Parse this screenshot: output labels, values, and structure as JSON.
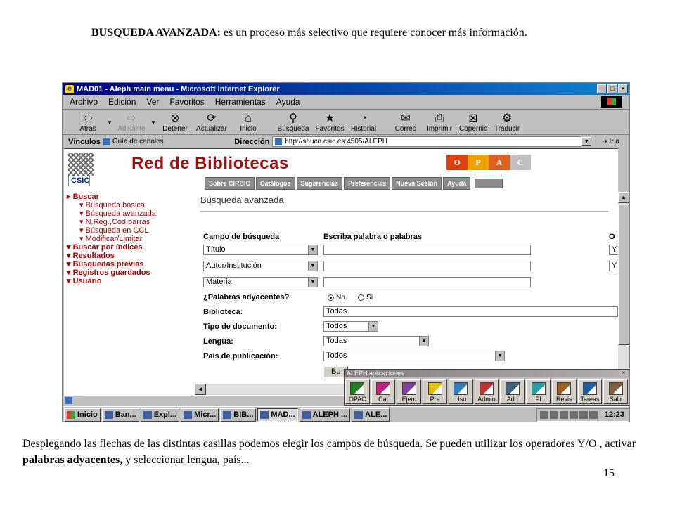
{
  "slide": {
    "title_bold": "BUSQUEDA AVANZADA:",
    "title_rest": " es un proceso más selectivo que requiere conocer más información.",
    "caption_part1": "Desplegando las flechas de las distintas casillas podemos elegir los campos de búsqueda. Se  pueden utilizar los operadores Y/O , activar ",
    "caption_bold": "palabras adyacentes,",
    "caption_part2": " y seleccionar lengua, país...",
    "page_number": "15"
  },
  "browser": {
    "window_title": "MAD01 - Aleph main menu - Microsoft Internet Explorer",
    "menu": [
      "Archivo",
      "Edición",
      "Ver",
      "Favoritos",
      "Herramientas",
      "Ayuda"
    ],
    "toolbar": [
      {
        "label": "Atrás",
        "icon": "back-arrow-icon",
        "glyph": "⇦"
      },
      {
        "label": "Adelante",
        "icon": "forward-arrow-icon",
        "glyph": "⇨"
      },
      {
        "label": "Detener",
        "icon": "stop-icon",
        "glyph": "⊗"
      },
      {
        "label": "Actualizar",
        "icon": "refresh-icon",
        "glyph": "⟳"
      },
      {
        "label": "Inicio",
        "icon": "home-icon",
        "glyph": "⌂"
      },
      {
        "label": "Búsqueda",
        "icon": "search-icon",
        "glyph": "⚲"
      },
      {
        "label": "Favoritos",
        "icon": "favorites-icon",
        "glyph": "★"
      },
      {
        "label": "Historial",
        "icon": "history-icon",
        "glyph": "◔"
      },
      {
        "label": "Correo",
        "icon": "mail-icon",
        "glyph": "✉"
      },
      {
        "label": "Imprimir",
        "icon": "print-icon",
        "glyph": "⎙"
      },
      {
        "label": "Copernic",
        "icon": "copernic-icon",
        "glyph": "⊠"
      },
      {
        "label": "Traducir",
        "icon": "translate-icon",
        "glyph": "⚙"
      }
    ],
    "links_label": "Vínculos",
    "links_item": "Guía de canales",
    "address_label": "Dirección",
    "address_value": "http://sauco.csic.es:4505/ALEPH",
    "go_label": "Ir a",
    "status_text": ""
  },
  "page": {
    "csic_label": "CSIC",
    "site_title": "Red de Bibliotecas",
    "opac_letters": [
      {
        "letter": "O",
        "color": "#e04010"
      },
      {
        "letter": "P",
        "color": "#f0a000"
      },
      {
        "letter": "A",
        "color": "#e06020"
      },
      {
        "letter": "C",
        "color": "#c0c0c0"
      }
    ],
    "nav_tabs": [
      "Sobre CIRBIC",
      "Catálogos",
      "Sugerencias",
      "Preferencias",
      "Nueva Sesión",
      "Ayuda"
    ],
    "left_menu": [
      {
        "label": "Buscar",
        "level": "main",
        "arrow": "▸"
      },
      {
        "label": "Búsqueda básica",
        "level": "sub",
        "arrow": "▾"
      },
      {
        "label": "Búsqueda avanzada",
        "level": "sub",
        "arrow": "▾"
      },
      {
        "label": "N.Reg.,Cód.barras",
        "level": "sub",
        "arrow": "▾"
      },
      {
        "label": "Búsqueda en CCL",
        "level": "sub",
        "arrow": "▾"
      },
      {
        "label": "Modificar/Limitar",
        "level": "sub",
        "arrow": "▾"
      },
      {
        "label": "Buscar por índices",
        "level": "main",
        "arrow": "▾"
      },
      {
        "label": "Resultados",
        "level": "main",
        "arrow": "▾"
      },
      {
        "label": "Búsquedas previas",
        "level": "main",
        "arrow": "▾"
      },
      {
        "label": "Registros guardados",
        "level": "main",
        "arrow": "▾"
      },
      {
        "label": "Usuario",
        "level": "main",
        "arrow": "▾"
      }
    ],
    "form": {
      "section_title": "Búsqueda avanzada",
      "col_field": "Campo de búsqueda",
      "col_words": "Escriba palabra o palabras",
      "col_op": "O",
      "rows": [
        {
          "field": "Título",
          "words": "",
          "op": "Y"
        },
        {
          "field": "Autor/Institución",
          "words": "",
          "op": "Y"
        },
        {
          "field": "Materia",
          "words": ""
        }
      ],
      "adjacent_label": "¿Palabras adyacentes?",
      "adjacent_no": "No",
      "adjacent_si": "Sí",
      "library_label": "Biblioteca:",
      "library_value": "Todas",
      "doctype_label": "Tipo de documento:",
      "doctype_value": "Todos",
      "language_label": "Lengua:",
      "language_value": "Todas",
      "country_label": "País de publicación:",
      "country_value": "Todos",
      "search_button": "Bu"
    }
  },
  "aleph_bar": {
    "title": "ALEPH aplicaciones",
    "apps": [
      {
        "label": "OPAC",
        "color": "#208020"
      },
      {
        "label": "Cat",
        "color": "#c02080"
      },
      {
        "label": "Ejem",
        "color": "#8040a0"
      },
      {
        "label": "Pre",
        "color": "#e0c000"
      },
      {
        "label": "Usu",
        "color": "#3080c0"
      },
      {
        "label": "Admin",
        "color": "#c03030"
      },
      {
        "label": "Adq",
        "color": "#406080"
      },
      {
        "label": "Pl",
        "color": "#20a0a0"
      },
      {
        "label": "Revis",
        "color": "#a06020"
      },
      {
        "label": "Tareas",
        "color": "#2060a0"
      },
      {
        "label": "Salir",
        "color": "#806040"
      }
    ]
  },
  "taskbar": {
    "start": "Inicio",
    "tasks": [
      "Ban...",
      "Expl...",
      "Micr...",
      "BIB...",
      "MAD...",
      "ALEPH ...",
      "ALE..."
    ],
    "active_index": 4,
    "clock": "12:23"
  }
}
